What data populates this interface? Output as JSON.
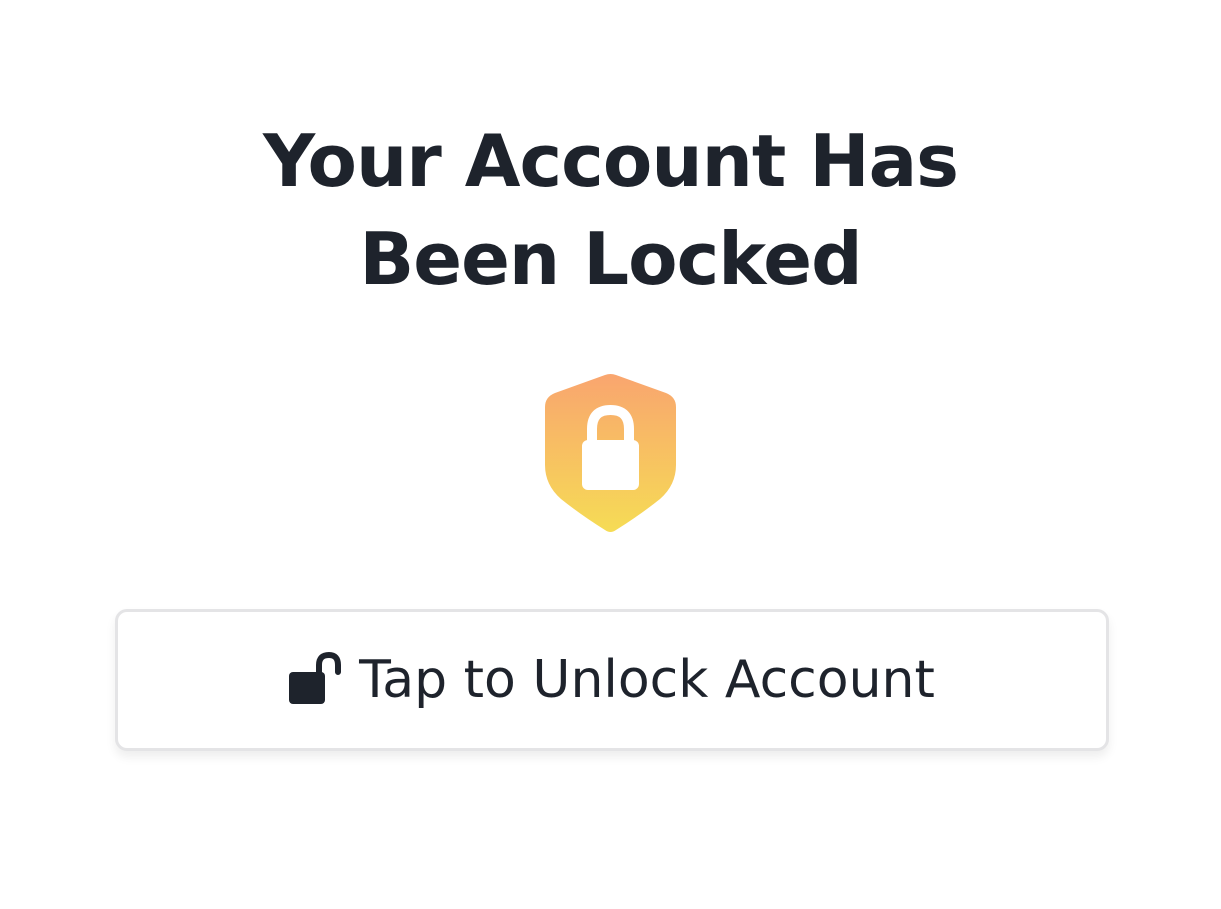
{
  "lock_screen": {
    "title_line_1": "Your Account Has",
    "title_line_2": "Been Locked",
    "shield_icon": "shield-lock-icon",
    "shield_gradient": [
      "#f9a56f",
      "#f6dc55"
    ],
    "unlock_button": {
      "label": "Tap to Unlock Account",
      "icon": "unlocked-padlock-icon"
    },
    "text_color": "#1e232c"
  }
}
